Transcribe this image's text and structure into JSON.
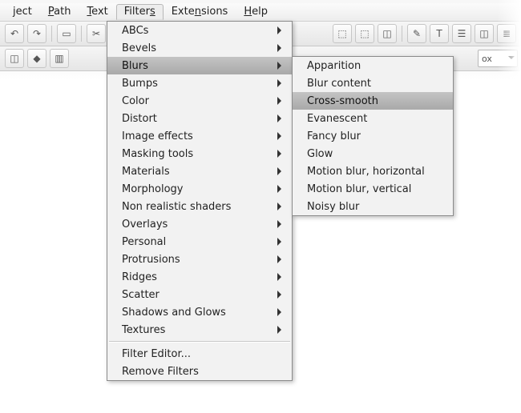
{
  "menubar": {
    "items": [
      {
        "pre": "",
        "ul": "",
        "post": "ject"
      },
      {
        "pre": "",
        "ul": "P",
        "post": "ath"
      },
      {
        "pre": "",
        "ul": "T",
        "post": "ext"
      },
      {
        "pre": "Filter",
        "ul": "s",
        "post": ""
      },
      {
        "pre": "Exte",
        "ul": "n",
        "post": "sions"
      },
      {
        "pre": "",
        "ul": "H",
        "post": "elp"
      }
    ],
    "open_index": 3
  },
  "toolbar_a": {
    "left_icons": [
      "↶",
      "↷",
      "▭",
      "✂",
      "▣",
      "▣"
    ],
    "right_icons": [
      "⬚",
      "⬚",
      "◫",
      "✎",
      "T",
      "☰",
      "◫",
      "≣"
    ]
  },
  "toolbar_b": {
    "left_icons": [
      "◫",
      "◆",
      "▥"
    ],
    "combo_label": "ox"
  },
  "filters_menu": {
    "groups": [
      [
        {
          "label": "ABCs",
          "sub": true
        },
        {
          "label": "Bevels",
          "sub": true
        },
        {
          "label": "Blurs",
          "sub": true,
          "hover": true
        },
        {
          "label": "Bumps",
          "sub": true
        },
        {
          "label": "Color",
          "sub": true
        },
        {
          "label": "Distort",
          "sub": true
        },
        {
          "label": "Image effects",
          "sub": true
        },
        {
          "label": "Masking tools",
          "sub": true
        },
        {
          "label": "Materials",
          "sub": true
        },
        {
          "label": "Morphology",
          "sub": true
        },
        {
          "label": "Non realistic shaders",
          "sub": true
        },
        {
          "label": "Overlays",
          "sub": true
        },
        {
          "label": "Personal",
          "sub": true
        },
        {
          "label": "Protrusions",
          "sub": true
        },
        {
          "label": "Ridges",
          "sub": true
        },
        {
          "label": "Scatter",
          "sub": true
        },
        {
          "label": "Shadows and Glows",
          "sub": true
        },
        {
          "label": "Textures",
          "sub": true
        }
      ],
      [
        {
          "label": "Filter Editor...",
          "sub": false
        },
        {
          "label": "Remove Filters",
          "sub": false
        }
      ]
    ]
  },
  "blurs_submenu": {
    "items": [
      {
        "label": "Apparition"
      },
      {
        "label": "Blur content"
      },
      {
        "label": "Cross-smooth",
        "hover": true
      },
      {
        "label": "Evanescent"
      },
      {
        "label": "Fancy blur"
      },
      {
        "label": "Glow"
      },
      {
        "label": "Motion blur, horizontal"
      },
      {
        "label": "Motion blur, vertical"
      },
      {
        "label": "Noisy blur"
      }
    ]
  }
}
